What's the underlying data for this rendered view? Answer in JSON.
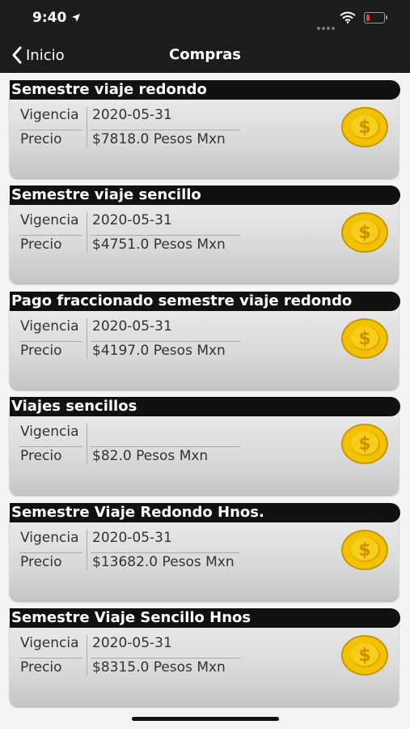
{
  "status": {
    "time": "9:40"
  },
  "nav": {
    "back_label": "Inicio",
    "title": "Compras"
  },
  "labels": {
    "vigencia": "Vigencia",
    "precio": "Precio"
  },
  "purchases": [
    {
      "title": "Semestre viaje redondo",
      "vigencia": "2020-05-31",
      "precio": "$7818.0 Pesos Mxn"
    },
    {
      "title": "Semestre viaje sencillo",
      "vigencia": "2020-05-31",
      "precio": "$4751.0 Pesos Mxn"
    },
    {
      "title": "Pago fraccionado semestre viaje redondo",
      "vigencia": "2020-05-31",
      "precio": "$4197.0 Pesos Mxn"
    },
    {
      "title": "Viajes sencillos",
      "vigencia": "",
      "precio": "$82.0 Pesos Mxn"
    },
    {
      "title": "Semestre Viaje Redondo Hnos.",
      "vigencia": "2020-05-31",
      "precio": "$13682.0 Pesos Mxn"
    },
    {
      "title": "Semestre Viaje Sencillo Hnos",
      "vigencia": "2020-05-31",
      "precio": "$8315.0 Pesos Mxn"
    }
  ],
  "icons": {
    "back": "chevron-left-icon",
    "coin": "dollar-coin-icon",
    "wifi": "wifi-icon",
    "battery": "battery-icon",
    "location": "location-arrow-icon"
  },
  "colors": {
    "bar": "#1c1c1c",
    "title_strip": "#111111",
    "coin_gold": "#f2c200",
    "battery_low": "#e53935"
  }
}
